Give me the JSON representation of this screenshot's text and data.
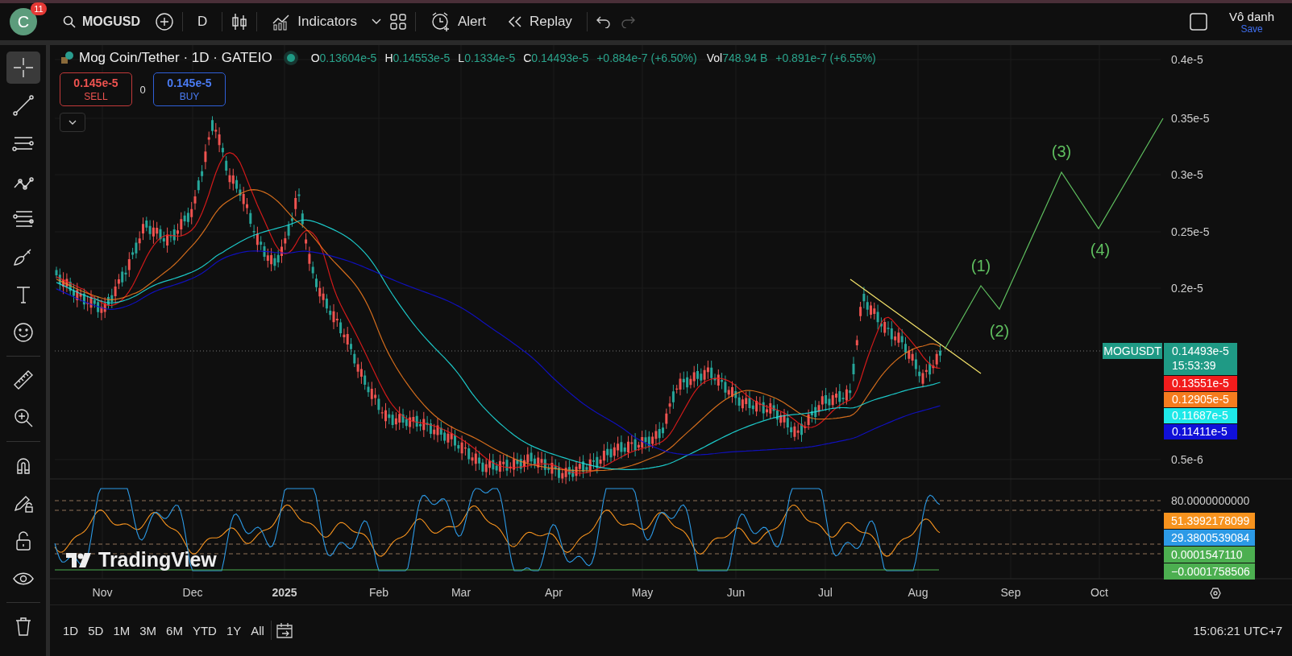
{
  "top_bar": {
    "avatar_letter": "C",
    "notification_count": "11",
    "symbol": "MOGUSD",
    "interval": "D",
    "indicators_label": "Indicators",
    "alert_label": "Alert",
    "replay_label": "Replay",
    "undo": {
      "disabled": false
    },
    "redo": {
      "disabled": true
    },
    "layout_name": "Vô danh",
    "save_label": "Save"
  },
  "left_toolbar": {
    "tool_groups": [
      [
        {
          "kind": "crosshair",
          "selected": true
        },
        {
          "kind": "trend-line",
          "selected": false
        },
        {
          "kind": "horizontal-lines",
          "selected": false
        },
        {
          "kind": "pattern",
          "selected": false
        },
        {
          "kind": "fib",
          "selected": false
        },
        {
          "kind": "brush",
          "selected": false
        },
        {
          "kind": "text",
          "selected": false
        },
        {
          "kind": "emoji",
          "selected": false
        }
      ],
      [
        {
          "kind": "ruler",
          "selected": false
        },
        {
          "kind": "zoom",
          "selected": false
        }
      ],
      [
        {
          "kind": "magnet",
          "selected": false
        },
        {
          "kind": "lock-draw",
          "selected": false
        },
        {
          "kind": "lock",
          "selected": false
        },
        {
          "kind": "eye",
          "selected": false
        }
      ],
      [
        {
          "kind": "trash",
          "selected": false
        }
      ]
    ]
  },
  "legend": {
    "title": "Mog Coin/Tether · 1D · GATEIO",
    "ohlc": [
      {
        "key": "O",
        "value": "0.13604e-5"
      },
      {
        "key": "H",
        "value": "0.14553e-5"
      },
      {
        "key": "L",
        "value": "0.1334e-5"
      },
      {
        "key": "C",
        "value": "0.14493e-5"
      }
    ],
    "change": "+0.884e-7 (+6.50%)",
    "volume_key": "Vol",
    "volume": "748.94 B",
    "volume_change": "+0.891e-7 (+6.55%)"
  },
  "trade": {
    "sell_price": "0.145e-5",
    "sell_label": "SELL",
    "spread": "0",
    "buy_price": "0.145e-5",
    "buy_label": "BUY"
  },
  "wave_labels": [
    "(1)",
    "(2)",
    "(3)",
    "(4)"
  ],
  "brand_logo": "TradingView",
  "price_axis": {
    "ticks": [
      "0.4e-5",
      "0.35e-5",
      "0.3e-5",
      "0.25e-5",
      "0.2e-5",
      "0.5e-6"
    ],
    "symbol_label": "MOGUSDT",
    "last_price": "0.14493e-5",
    "countdown": "15:53:39",
    "ma_badges": [
      {
        "value": "0.13551e-5",
        "color": "#f21c1c"
      },
      {
        "value": "0.12905e-5",
        "color": "#f57c1f"
      },
      {
        "value": "0.11687e-5",
        "color": "#1ee8e8"
      },
      {
        "value": "0.11411e-5",
        "color": "#1010d8"
      }
    ]
  },
  "rsi_axis": {
    "level": "80.0000000000",
    "badges": [
      {
        "value": "51.3992178099",
        "color": "#f7931e"
      },
      {
        "value": "29.3800539084",
        "color": "#2c9ae6"
      },
      {
        "value": "0.0001547110",
        "color": "#4caf50"
      },
      {
        "value": "−0.0001758506",
        "color": "#4caf50"
      }
    ]
  },
  "time_axis": [
    {
      "label": "Nov",
      "kind": "month"
    },
    {
      "label": "Dec",
      "kind": "month"
    },
    {
      "label": "2025",
      "kind": "year"
    },
    {
      "label": "Feb",
      "kind": "month"
    },
    {
      "label": "Mar",
      "kind": "month"
    },
    {
      "label": "Apr",
      "kind": "month"
    },
    {
      "label": "May",
      "kind": "month"
    },
    {
      "label": "Jun",
      "kind": "month"
    },
    {
      "label": "Jul",
      "kind": "month"
    },
    {
      "label": "Aug",
      "kind": "month"
    },
    {
      "label": "Sep",
      "kind": "month"
    },
    {
      "label": "Oct",
      "kind": "month"
    }
  ],
  "bottom_bar": {
    "ranges": [
      "1D",
      "5D",
      "1M",
      "3M",
      "6M",
      "YTD",
      "1Y",
      "All"
    ],
    "clock": "15:06:21 UTC+7"
  }
}
